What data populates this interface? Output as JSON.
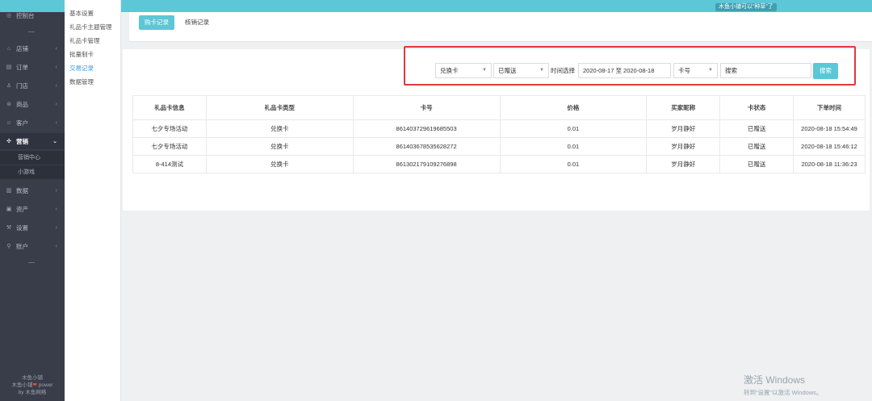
{
  "topbar": {
    "note": "木鱼小铺可以“种草”了"
  },
  "sidebar": {
    "items": [
      {
        "label": "控制台",
        "icon": "dashboard-icon",
        "glyph": "◎",
        "arrow": ""
      },
      {
        "label": "店铺",
        "icon": "store-icon",
        "glyph": "⌂",
        "arrow": "‹"
      },
      {
        "label": "订单",
        "icon": "order-icon",
        "glyph": "▤",
        "arrow": "‹"
      },
      {
        "label": "门店",
        "icon": "shop-icon",
        "glyph": "♙",
        "arrow": "‹"
      },
      {
        "label": "商品",
        "icon": "goods-icon",
        "glyph": "⊜",
        "arrow": "‹"
      },
      {
        "label": "客户",
        "icon": "customer-icon",
        "glyph": "☺",
        "arrow": "‹"
      },
      {
        "label": "营销",
        "icon": "marketing-icon",
        "glyph": "✣",
        "arrow": "⌄"
      },
      {
        "label": "数据",
        "icon": "data-icon",
        "glyph": "▥",
        "arrow": "‹"
      },
      {
        "label": "资产",
        "icon": "asset-icon",
        "glyph": "▣",
        "arrow": "‹"
      },
      {
        "label": "设置",
        "icon": "settings-icon",
        "glyph": "⚒",
        "arrow": "‹"
      },
      {
        "label": "账户",
        "icon": "account-icon",
        "glyph": "⚲",
        "arrow": "‹"
      }
    ],
    "sub_items": [
      "营销中心",
      "小游戏"
    ],
    "footer": {
      "line1": "木鱼小铺",
      "line2a": "木鱼小铺",
      "line2b": "power",
      "line3": "by 木鱼网络"
    }
  },
  "subnav": {
    "items": [
      "基本设置",
      "礼品卡主题管理",
      "礼品卡管理",
      "批量制卡",
      "交易记录",
      "数据管理"
    ],
    "current": 4
  },
  "tabs": {
    "buy": "购卡记录",
    "verify": "核销记录"
  },
  "filters": {
    "card_type": "兑换卡",
    "status": "已赠送",
    "time_label": "时间选择",
    "date_range": "2020-08-17 至 2020-08-18",
    "search_field": "卡号",
    "search_placeholder": "搜索",
    "search_button": "搜索"
  },
  "table": {
    "headers": [
      "礼品卡信息",
      "礼品卡类型",
      "卡号",
      "价格",
      "买家昵称",
      "卡状态",
      "下单时间"
    ],
    "rows": [
      [
        "七夕专场活动",
        "兑换卡",
        "861403729619685503",
        "0.01",
        "岁月静好",
        "已赠送",
        "2020-08-18 15:54:49"
      ],
      [
        "七夕专场活动",
        "兑换卡",
        "861403678535628272",
        "0.01",
        "岁月静好",
        "已赠送",
        "2020-08-18 15:46:12"
      ],
      [
        "8-414测试",
        "兑换卡",
        "861302179109276898",
        "0.01",
        "岁月静好",
        "已赠送",
        "2020-08-18 11:36:23"
      ]
    ]
  },
  "watermark": {
    "line1": "激活 Windows",
    "line2": "转到“设置”以激活 Windows。"
  }
}
